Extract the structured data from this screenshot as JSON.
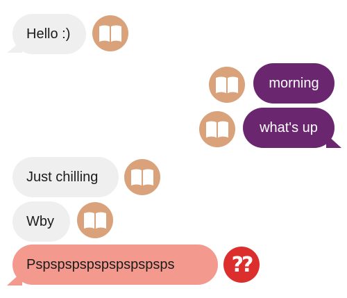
{
  "messages": [
    {
      "text": "Hello :)",
      "direction": "incoming",
      "avatar_icon": "open-book-icon"
    },
    {
      "text": "morning",
      "direction": "outgoing",
      "avatar_icon": "open-book-icon"
    },
    {
      "text": "what's up",
      "direction": "outgoing",
      "avatar_icon": "open-book-icon"
    },
    {
      "text": "Just chilling",
      "direction": "incoming",
      "avatar_icon": "open-book-icon"
    },
    {
      "text": "Wby",
      "direction": "incoming",
      "avatar_icon": "open-book-icon"
    },
    {
      "text": "Pspspspspspspspspsps",
      "direction": "incoming",
      "avatar_icon": "red-question-marks-icon",
      "avatar_label": "??"
    }
  ],
  "colors": {
    "incoming_bubble": "#efefef",
    "outgoing_bubble": "#6b2670",
    "alert_bubble": "#f4998d",
    "book_avatar": "#d9a27a",
    "question_avatar": "#dd2e2e"
  }
}
